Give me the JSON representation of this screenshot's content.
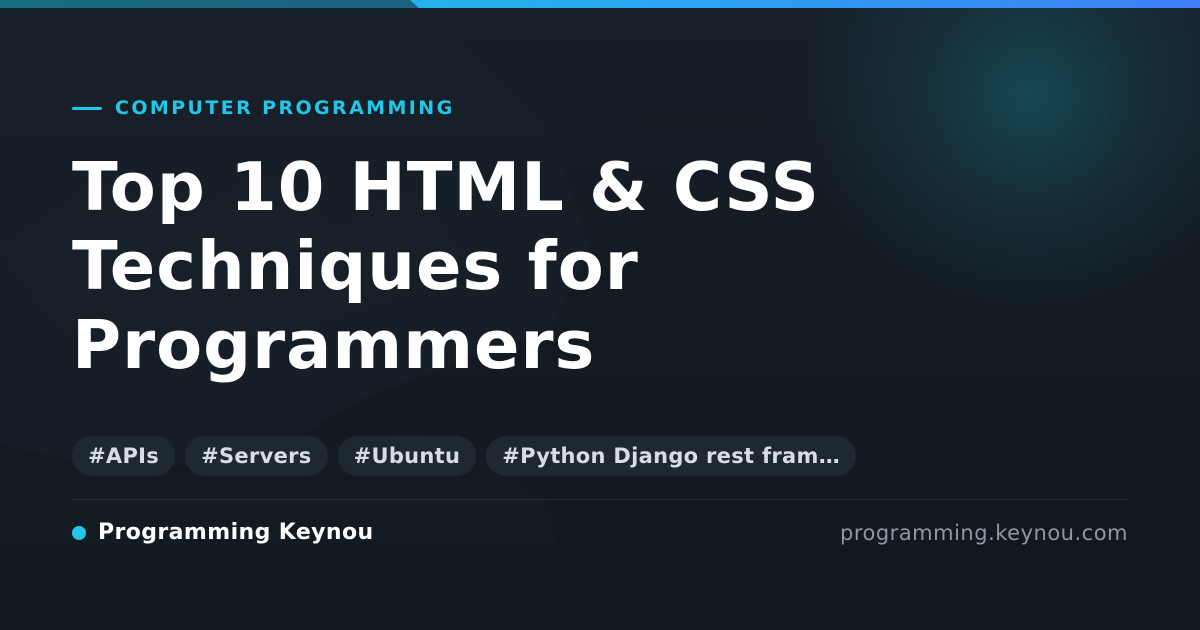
{
  "card": {
    "category": "COMPUTER PROGRAMMING",
    "title": "Top 10 HTML & CSS Techniques for Programmers",
    "tags": [
      "#APIs",
      "#Servers",
      "#Ubuntu",
      "#Python Django rest fram…"
    ],
    "brand_name": "Programming Keynou",
    "site_url": "programming.keynou.com"
  },
  "colors": {
    "accent": "#21c7e7",
    "background": "#141a22",
    "tag_background": "#1d2833",
    "title": "#ffffff",
    "muted": "#8e98a3"
  }
}
